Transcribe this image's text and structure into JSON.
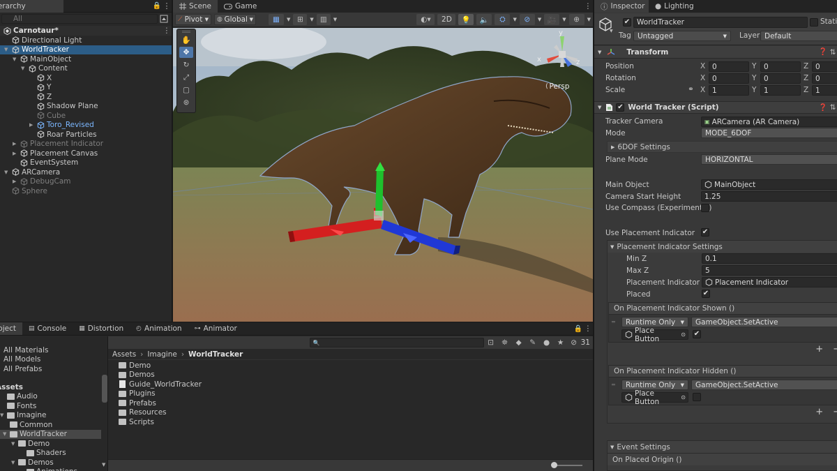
{
  "hierarchy": {
    "tab": "Hierarchy",
    "search_placeholder": "All",
    "scene": "Carnotaur*",
    "items": [
      {
        "label": "Directional Light",
        "depth": 1,
        "state": "normal"
      },
      {
        "label": "WorldTracker",
        "depth": 1,
        "state": "selected",
        "fold": "▼"
      },
      {
        "label": "MainObject",
        "depth": 2,
        "state": "normal",
        "fold": "▼"
      },
      {
        "label": "Content",
        "depth": 3,
        "state": "normal",
        "fold": "▼"
      },
      {
        "label": "X",
        "depth": 4,
        "state": "normal"
      },
      {
        "label": "Y",
        "depth": 4,
        "state": "normal"
      },
      {
        "label": "Z",
        "depth": 4,
        "state": "normal"
      },
      {
        "label": "Shadow Plane",
        "depth": 4,
        "state": "normal"
      },
      {
        "label": "Cube",
        "depth": 4,
        "state": "disabled"
      },
      {
        "label": "Toro_Revised",
        "depth": 4,
        "state": "prefab",
        "fold": "▶"
      },
      {
        "label": "Roar Particles",
        "depth": 4,
        "state": "normal"
      },
      {
        "label": "Placement Indicator",
        "depth": 2,
        "state": "disabled",
        "fold": "▶"
      },
      {
        "label": "Placement Canvas",
        "depth": 2,
        "state": "normal",
        "fold": "▶"
      },
      {
        "label": "EventSystem",
        "depth": 2,
        "state": "normal"
      },
      {
        "label": "ARCamera",
        "depth": 1,
        "state": "normal",
        "fold": "▼"
      },
      {
        "label": "DebugCam",
        "depth": 2,
        "state": "disabled",
        "fold": "▶"
      },
      {
        "label": "Sphere",
        "depth": 1,
        "state": "disabled"
      }
    ]
  },
  "scene_view": {
    "tabs": [
      "Scene",
      "Game"
    ],
    "pivot": "Pivot",
    "global": "Global",
    "mode_2d": "2D",
    "persp": "Persp",
    "axes": {
      "x": "x",
      "y": "y",
      "z": "z"
    }
  },
  "bottom": {
    "tabs": [
      "Project",
      "Console",
      "Distortion",
      "Animation",
      "Animator"
    ],
    "favorites": [
      "All Materials",
      "All Models",
      "All Prefabs"
    ],
    "assets_header": "Assets",
    "folders": [
      {
        "label": "Audio",
        "depth": 1
      },
      {
        "label": "Fonts",
        "depth": 1
      },
      {
        "label": "Imagine",
        "depth": 1,
        "fold": "▼"
      },
      {
        "label": "Common",
        "depth": 2
      },
      {
        "label": "WorldTracker",
        "depth": 2,
        "fold": "▼",
        "selected": true
      },
      {
        "label": "Demo",
        "depth": 3,
        "fold": "▼"
      },
      {
        "label": "Shaders",
        "depth": 4
      },
      {
        "label": "Demos",
        "depth": 3,
        "fold": "▼"
      },
      {
        "label": "Animations",
        "depth": 4
      }
    ],
    "breadcrumb": [
      "Assets",
      "Imagine",
      "WorldTracker"
    ],
    "files": [
      {
        "label": "Demo",
        "kind": "folder"
      },
      {
        "label": "Demos",
        "kind": "folder"
      },
      {
        "label": "Guide_WorldTracker",
        "kind": "doc"
      },
      {
        "label": "Plugins",
        "kind": "folder"
      },
      {
        "label": "Prefabs",
        "kind": "folder"
      },
      {
        "label": "Resources",
        "kind": "folder"
      },
      {
        "label": "Scripts",
        "kind": "folder"
      }
    ],
    "count": "31"
  },
  "inspector": {
    "tabs": [
      "Inspector",
      "Lighting"
    ],
    "object_name": "WorldTracker",
    "static_label": "Static",
    "tag_label": "Tag",
    "tag_value": "Untagged",
    "layer_label": "Layer",
    "layer_value": "Default",
    "transform": {
      "title": "Transform",
      "rows": [
        {
          "label": "Position",
          "x": "0",
          "y": "0",
          "z": "0"
        },
        {
          "label": "Rotation",
          "x": "0",
          "y": "0",
          "z": "0"
        },
        {
          "label": "Scale",
          "x": "1",
          "y": "1",
          "z": "1"
        }
      ]
    },
    "script": {
      "title": "World Tracker (Script)",
      "tracker_camera_label": "Tracker Camera",
      "tracker_camera_value": "ARCamera (AR Camera)",
      "mode_label": "Mode",
      "mode_value": "MODE_6DOF",
      "dof_settings": "6DOF Settings",
      "plane_mode_label": "Plane Mode",
      "plane_mode_value": "HORIZONTAL",
      "main_object_label": "Main Object",
      "main_object_value": "MainObject",
      "camera_start_height_label": "Camera Start Height",
      "camera_start_height_value": "1.25",
      "use_compass_label": "Use Compass (Experimental)",
      "use_placement_label": "Use Placement Indicator",
      "placement_settings": "Placement Indicator Settings",
      "min_z_label": "Min Z",
      "min_z_value": "0.1",
      "max_z_label": "Max Z",
      "max_z_value": "5",
      "placement_indicator_label": "Placement Indicator",
      "placement_indicator_value": "Placement Indicator",
      "placed_label": "Placed",
      "event_shown": "On Placement Indicator Shown ()",
      "event_hidden": "On Placement Indicator Hidden ()",
      "runtime_only": "Runtime Only",
      "function": "GameObject.SetActive",
      "target": "Place Button",
      "event_settings": "Event Settings",
      "event_placed_origin": "On Placed Origin ()"
    }
  }
}
